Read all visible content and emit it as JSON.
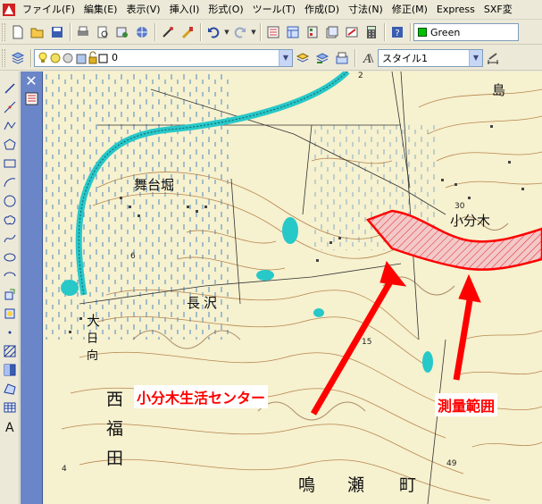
{
  "menubar": {
    "items": [
      "ファイル(F)",
      "編集(E)",
      "表示(V)",
      "挿入(I)",
      "形式(O)",
      "ツール(T)",
      "作成(D)",
      "寸法(N)",
      "修正(M)",
      "Express",
      "SXF変"
    ]
  },
  "toolbar1": {
    "color_combo": {
      "value": "Green",
      "swatch_color": "#00c000"
    },
    "icons": [
      "new-icon",
      "open-icon",
      "save-icon",
      "print-icon",
      "preview-icon",
      "publish-icon",
      "plot-icon",
      "match-icon",
      "brush-icon",
      "undo-icon",
      "redo-icon",
      "properties-icon",
      "designcenter-icon",
      "toolpalette-icon",
      "sheetset-icon",
      "markup-icon",
      "calculator-icon",
      "help-icon"
    ]
  },
  "toolbar2": {
    "layer_combo": {
      "value": "0"
    },
    "style_combo": {
      "value": "スタイル1"
    }
  },
  "map": {
    "labels": {
      "maidaibori": "舞台堀",
      "nagasawa": "長沢",
      "kowakegi": "小分木",
      "shima": "島",
      "oohinata": [
        "大",
        "日",
        "向"
      ],
      "nishifukuda": [
        "西",
        "福",
        "田"
      ],
      "narusecho": [
        "鳴",
        "瀬",
        "町"
      ]
    },
    "numbers": {
      "n6": "6",
      "n15": "15",
      "n4": "4",
      "n49": "49",
      "n30": "30",
      "n2": "2"
    },
    "annotations": {
      "center": "小分木生活センター",
      "survey": "測量範囲"
    },
    "colors": {
      "river": "#27c8c8",
      "annotation": "#ff0000",
      "map_bg": "#f6f1cf"
    }
  }
}
